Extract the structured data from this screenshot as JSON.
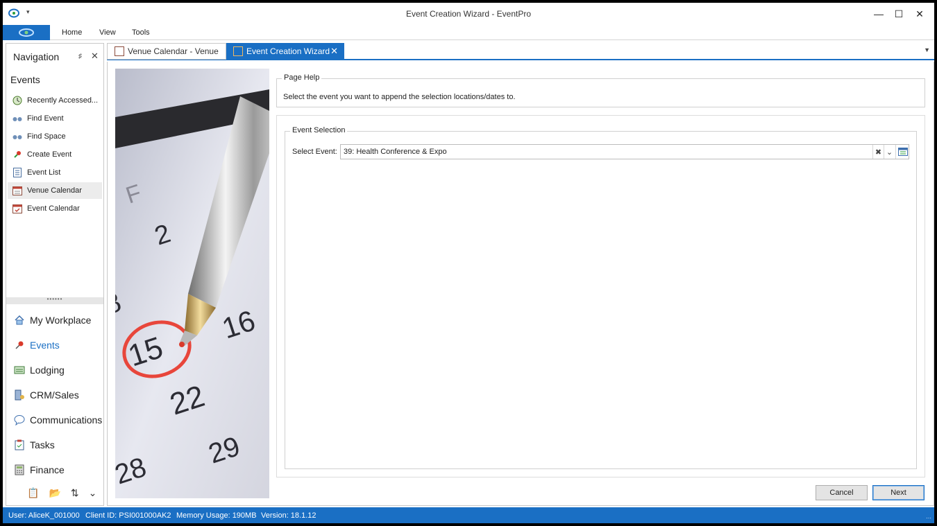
{
  "window": {
    "title": "Event Creation Wizard - EventPro",
    "minimize": "—",
    "maximize": "☐",
    "close": "✕"
  },
  "menu": {
    "items": [
      "Home",
      "View",
      "Tools"
    ]
  },
  "navigation": {
    "header": "Navigation",
    "section": "Events",
    "items": [
      {
        "label": "Recently Accessed...",
        "icon": "clock-icon"
      },
      {
        "label": "Find Event",
        "icon": "binoculars-icon"
      },
      {
        "label": "Find Space",
        "icon": "binoculars-icon"
      },
      {
        "label": "Create Event",
        "icon": "pin-icon"
      },
      {
        "label": "Event List",
        "icon": "list-icon"
      },
      {
        "label": "Venue Calendar",
        "icon": "calendar-icon"
      },
      {
        "label": "Event Calendar",
        "icon": "calendar-check-icon"
      }
    ],
    "active_item": "Venue Calendar",
    "modules": [
      {
        "label": "My Workplace",
        "icon": "home-icon"
      },
      {
        "label": "Events",
        "icon": "pushpin-icon"
      },
      {
        "label": "Lodging",
        "icon": "bed-icon"
      },
      {
        "label": "CRM/Sales",
        "icon": "building-icon"
      },
      {
        "label": "Communications",
        "icon": "speech-bubble-icon"
      },
      {
        "label": "Tasks",
        "icon": "clipboard-icon"
      },
      {
        "label": "Finance",
        "icon": "calculator-icon"
      }
    ],
    "selected_module": "Events"
  },
  "tabs": [
    {
      "label": "Venue Calendar - Venue",
      "icon": "calendar-icon",
      "active": false
    },
    {
      "label": "Event Creation Wizard",
      "icon": "wizard-icon",
      "active": true
    }
  ],
  "page_help": {
    "title": "Page Help",
    "text": "Select the event you want to append the selection locations/dates to."
  },
  "event_selection": {
    "title": "Event Selection",
    "label": "Select Event:",
    "value": "39: Health Conference & Expo"
  },
  "buttons": {
    "cancel": "Cancel",
    "next": "Next"
  },
  "status": {
    "user": "User: AliceK_001000",
    "client": "Client ID: PSI001000AK2",
    "memory": "Memory Usage: 190MB",
    "version": "Version: 18.1.12"
  },
  "colors": {
    "accent": "#1a6fc4",
    "highlight_circle": "#e8463b"
  }
}
